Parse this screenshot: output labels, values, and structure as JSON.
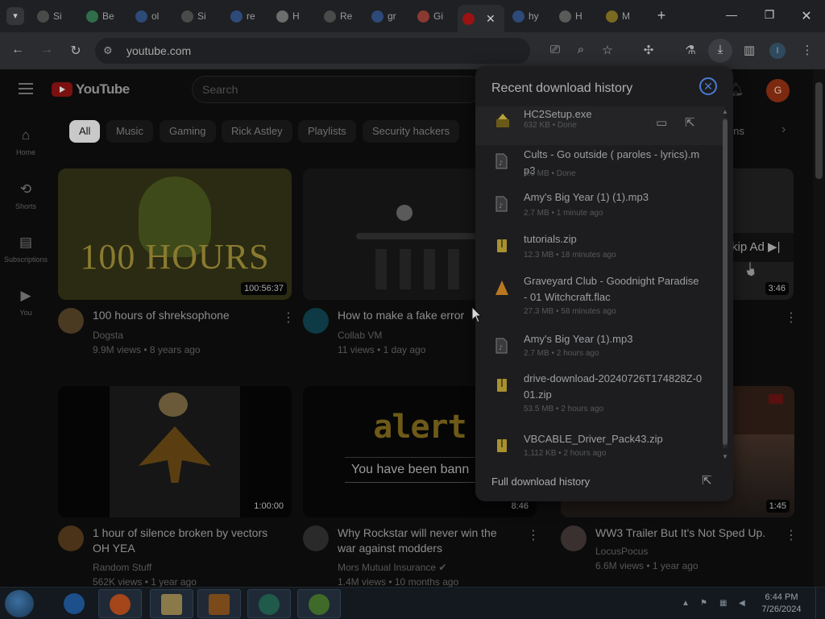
{
  "browser": {
    "tabs": [
      {
        "label": "Si",
        "favicon": "google-g",
        "color": "#4a4a4a"
      },
      {
        "label": "Be",
        "favicon": "green-circle",
        "color": "#2f6e4a"
      },
      {
        "label": "ol",
        "favicon": "search",
        "color": "#2d4a78"
      },
      {
        "label": "Si",
        "favicon": "google-g",
        "color": "#4a4a4a"
      },
      {
        "label": "re",
        "favicon": "search",
        "color": "#2d4a78"
      },
      {
        "label": "H",
        "favicon": "chrome",
        "color": "#6d6d6d"
      },
      {
        "label": "Re",
        "favicon": "google-g",
        "color": "#4a4a4a"
      },
      {
        "label": "gr",
        "favicon": "search",
        "color": "#2d4a78"
      },
      {
        "label": "Gi",
        "favicon": "gmail",
        "color": "#8a3a30"
      },
      {
        "label": "",
        "favicon": "youtube",
        "color": "#9a1212",
        "active": true
      },
      {
        "label": "hy",
        "favicon": "search",
        "color": "#2d4a78"
      },
      {
        "label": "H",
        "favicon": "bank",
        "color": "#5a5a5a"
      },
      {
        "label": "M",
        "favicon": "drive",
        "color": "#7a6a20"
      }
    ],
    "url": "youtube.com"
  },
  "youtube": {
    "logo_text": "YouTube",
    "search_placeholder": "Search",
    "avatar_letter": "G",
    "sidebar": [
      {
        "label": "Home",
        "icon": "home-icon",
        "glyph": "⌂"
      },
      {
        "label": "Shorts",
        "icon": "shorts-icon",
        "glyph": "⟲"
      },
      {
        "label": "Subscriptions",
        "icon": "subscriptions-icon",
        "glyph": "▤"
      },
      {
        "label": "You",
        "icon": "you-icon",
        "glyph": "▶"
      }
    ],
    "chips": [
      "All",
      "Music",
      "Gaming",
      "Rick Astley",
      "Playlists",
      "Security hackers"
    ],
    "chip_partial": "ions",
    "videos": [
      {
        "title": "100 hours of shreksophone",
        "channel": "Dogsta",
        "meta": "9.9M views • 8 years ago",
        "duration": "100:56:37",
        "thumb_text": "100 HOURS"
      },
      {
        "title": "How to make a fake error",
        "channel": "Collab VM",
        "meta": "11 views • 1 day ago",
        "duration": ""
      },
      {
        "title": "",
        "channel": "",
        "meta": "",
        "duration": "3:46",
        "thumb_text": "kip Ad ▶|"
      },
      {
        "title": "1 hour of silence broken by vectors OH YEA",
        "channel": "Random Stuff",
        "meta": "562K views • 1 year ago",
        "duration": "1:00:00"
      },
      {
        "title": "Why Rockstar will never win the war against modders",
        "channel": "Mors Mutual Insurance",
        "meta": "1.4M views • 10 months ago",
        "duration": "8:46",
        "thumb_text": "alert",
        "thumb_sub": "You have been bann"
      },
      {
        "title": "WW3 Trailer But It's Not Sped Up.",
        "channel": "LocusPocus",
        "meta": "6.6M views • 1 year ago",
        "duration": "1:45"
      }
    ]
  },
  "downloads": {
    "title": "Recent download history",
    "items": [
      {
        "name": "HC2Setup.exe",
        "meta": "632 KB • Done",
        "icon": "installer-icon",
        "color": "#b8a13a"
      },
      {
        "name": "Cults - Go outside ( paroles - lyrics).mp3",
        "meta": "3.0 MB • Done",
        "icon": "audio-file-icon",
        "color": "#7a7a7a"
      },
      {
        "name": "Amy's Big Year (1) (1).mp3",
        "meta": "2.7 MB • 1 minute ago",
        "icon": "audio-file-icon",
        "color": "#7a7a7a"
      },
      {
        "name": "tutorials.zip",
        "meta": "12.3 MB • 18 minutes ago",
        "icon": "zip-folder-icon",
        "color": "#a89230"
      },
      {
        "name": "Graveyard Club - Goodnight Paradise - 01 Witchcraft.flac",
        "meta": "27.3 MB • 58 minutes ago",
        "icon": "vlc-icon",
        "color": "#b8781f"
      },
      {
        "name": "Amy's Big Year (1).mp3",
        "meta": "2.7 MB • 2 hours ago",
        "icon": "audio-file-icon",
        "color": "#7a7a7a"
      },
      {
        "name": "drive-download-20240726T174828Z-001.zip",
        "meta": "53.5 MB • 2 hours ago",
        "icon": "zip-folder-icon",
        "color": "#a89230"
      },
      {
        "name": "VBCABLE_Driver_Pack43.zip",
        "meta": "1,112 KB • 2 hours ago",
        "icon": "zip-folder-icon",
        "color": "#a89230"
      }
    ],
    "footer": "Full download history"
  },
  "taskbar": {
    "time": "6:44 PM",
    "date": "7/26/2024"
  }
}
